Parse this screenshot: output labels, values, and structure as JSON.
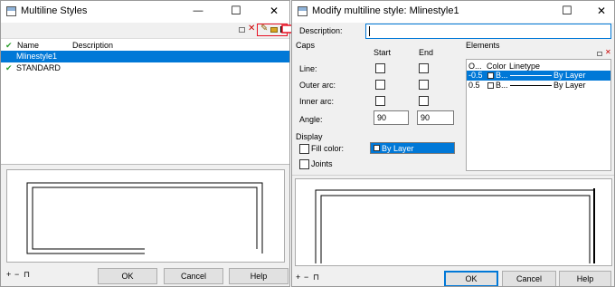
{
  "left_dialog": {
    "title": "Multiline Styles",
    "minimize_glyph": "—",
    "maximize_glyph": "☐",
    "close_glyph": "✕",
    "toolbar_icons": [
      "restore-small-icon",
      "delete-x-icon",
      "pencil-edit-icon",
      "folder-open-icon",
      "save-disk-icon"
    ],
    "columns": {
      "name": "Name",
      "description": "Description"
    },
    "styles": [
      {
        "name": "Mlinestyle1",
        "selected": true,
        "checked": false
      },
      {
        "name": "STANDARD",
        "selected": false,
        "checked": true
      }
    ],
    "footer_glyphs": [
      "+",
      "−",
      "⊓"
    ],
    "buttons": {
      "ok": "OK",
      "cancel": "Cancel",
      "help": "Help"
    }
  },
  "right_dialog": {
    "title": "Modify multiline style: Mlinestyle1",
    "close_glyph": "✕",
    "maximize_glyph": "☐",
    "description_label": "Description:",
    "description_value": "",
    "caps": {
      "heading": "Caps",
      "start_label": "Start",
      "end_label": "End",
      "rows": [
        "Line:",
        "Outer arc:",
        "Inner arc:"
      ],
      "angle_label": "Angle:",
      "angle_start": "90",
      "angle_end": "90"
    },
    "display": {
      "heading": "Display",
      "fill_color_label": "Fill color:",
      "fill_color_value": "By Layer",
      "joints_label": "Joints"
    },
    "elements": {
      "heading": "Elements",
      "header_icons": [
        "restore-small-icon",
        "delete-x-icon"
      ],
      "columns": {
        "offset": "O...",
        "color": "Color",
        "linetype": "Linetype"
      },
      "rows": [
        {
          "offset": "-0.5",
          "color": "B...",
          "linetype": "By Layer",
          "selected": true
        },
        {
          "offset": "0.5",
          "color": "B...",
          "linetype": "By Layer",
          "selected": false
        }
      ]
    },
    "footer_glyphs": [
      "+",
      "−",
      "⊓"
    ],
    "buttons": {
      "ok": "OK",
      "cancel": "Cancel",
      "help": "Help"
    }
  },
  "colors": {
    "selection": "#0078d7",
    "highlight_box": "#e81123",
    "arrow": "#e81123"
  }
}
